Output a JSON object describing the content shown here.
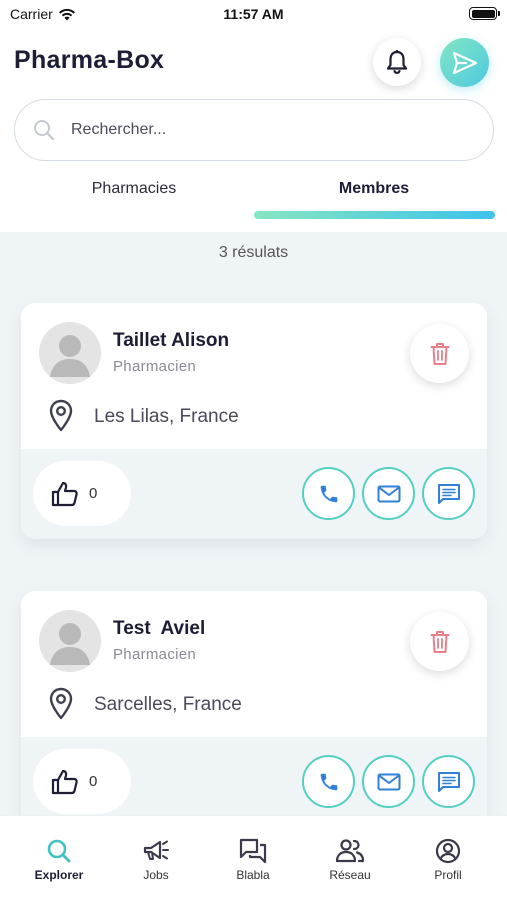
{
  "status_bar": {
    "carrier": "Carrier",
    "time": "11:57 AM"
  },
  "header": {
    "title": "Pharma-Box",
    "icons": {
      "notifications": "bell-icon",
      "send": "send-icon"
    }
  },
  "search": {
    "placeholder": "Rechercher...",
    "value": "",
    "icon": "search-icon"
  },
  "tabs": [
    {
      "label": "Pharmacies",
      "active": false
    },
    {
      "label": "Membres",
      "active": true
    }
  ],
  "results": {
    "text": "3 résulats"
  },
  "members": [
    {
      "name": "Taillet Alison",
      "role": "Pharmacien",
      "location": "Les Lilas, France",
      "likes": "0"
    },
    {
      "name": "Test  Aviel",
      "role": "Pharmacien",
      "location": "Sarcelles, France",
      "likes": "0"
    }
  ],
  "nav": [
    {
      "label": "Explorer",
      "icon": "search-icon",
      "active": true
    },
    {
      "label": "Jobs",
      "icon": "megaphone-icon",
      "active": false
    },
    {
      "label": "Blabla",
      "icon": "chat-icon",
      "active": false
    },
    {
      "label": "Réseau",
      "icon": "network-icon",
      "active": false
    },
    {
      "label": "Profil",
      "icon": "profile-icon",
      "active": false
    }
  ],
  "colors": {
    "accent_teal": "#53d0c2",
    "accent_blue": "#3fc2ea",
    "delete_red": "#e8808a",
    "background": "#eff4f7"
  }
}
